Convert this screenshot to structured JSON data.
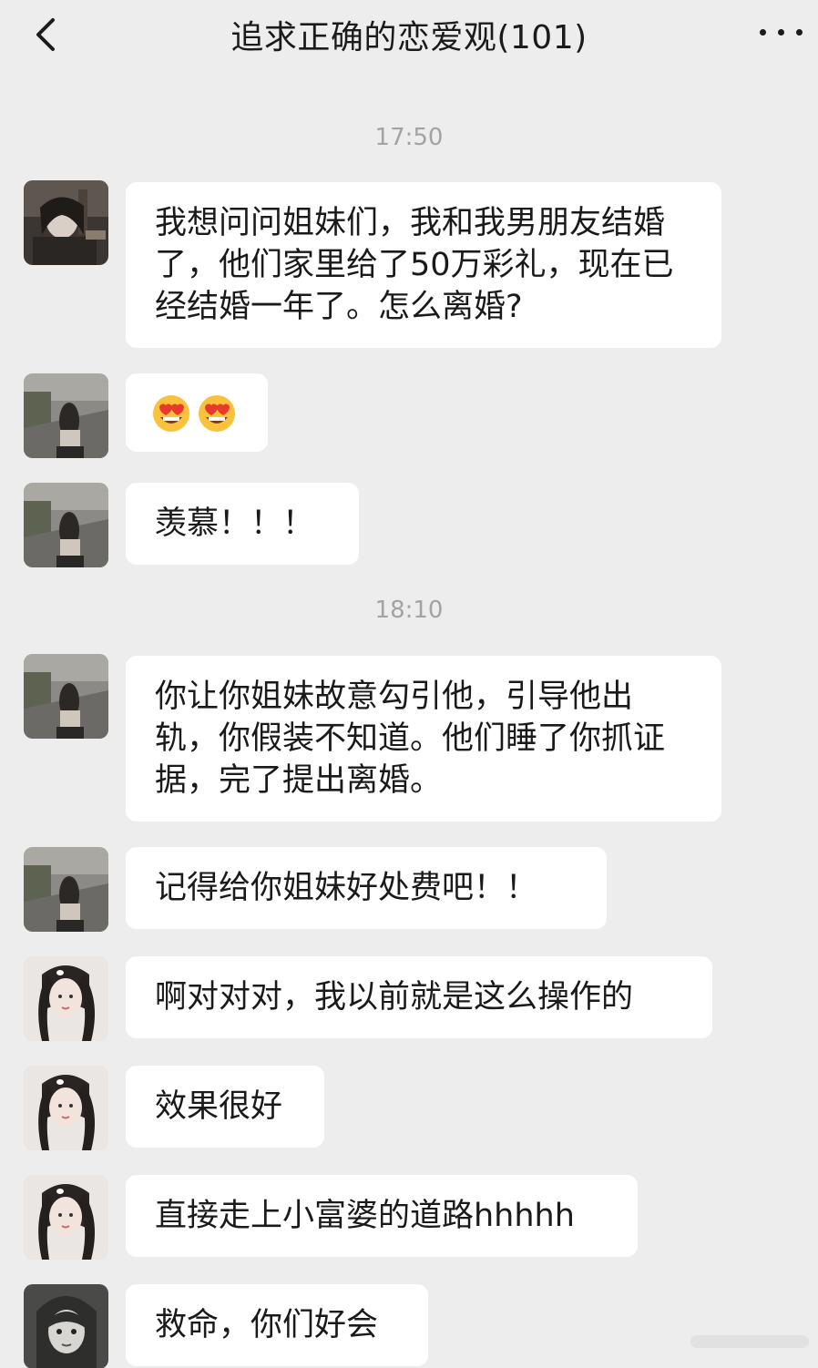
{
  "header": {
    "title": "追求正确的恋爱观(101)",
    "back_icon": "chevron-left-icon",
    "more_icon": "more-horizontal-icon"
  },
  "timestamps": [
    "17:50",
    "18:10"
  ],
  "messages": [
    {
      "avatar": "avatar-dark-woman",
      "text": "我想问问姐妹们，我和我男朋友结婚了，他们家里给了50万彩礼，现在已经结婚一年了。怎么离婚?"
    },
    {
      "avatar": "avatar-street-girl",
      "text": "",
      "emoji": [
        "heart-eyes-face-icon",
        "heart-eyes-face-icon"
      ]
    },
    {
      "avatar": "avatar-street-girl",
      "text": "羡慕！！！"
    },
    {
      "avatar": "avatar-street-girl",
      "text": "你让你姐妹故意勾引他，引导他出轨，你假装不知道。他们睡了你抓证据，完了提出离婚。"
    },
    {
      "avatar": "avatar-street-girl",
      "text": "记得给你姐妹好处费吧！！"
    },
    {
      "avatar": "avatar-pigtail-girl",
      "text": "啊对对对，我以前就是这么操作的"
    },
    {
      "avatar": "avatar-pigtail-girl",
      "text": "效果很好"
    },
    {
      "avatar": "avatar-pigtail-girl",
      "text": "直接走上小富婆的道路hhhhh"
    },
    {
      "avatar": "avatar-anime-girl",
      "text": "救命，你们好会"
    }
  ],
  "colors": {
    "background": "#ededed",
    "bubble": "#ffffff",
    "text": "#1a1a1a",
    "timestamp": "#a3a3a3"
  }
}
